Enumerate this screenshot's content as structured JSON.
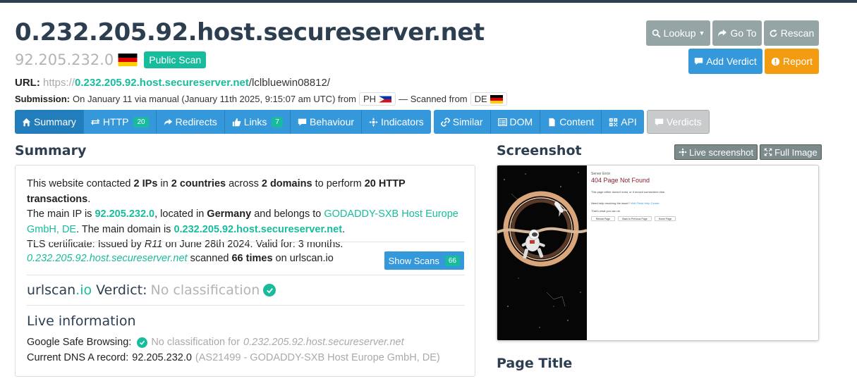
{
  "header": {
    "title": "0.232.205.92.host.secureserver.net",
    "ip": "92.205.232.0",
    "public_badge": "Public Scan"
  },
  "url": {
    "label": "URL:",
    "scheme": "https://",
    "domain": "0.232.205.92.host.secureserver.net",
    "path": "/lclbluewin08812/"
  },
  "submission": {
    "label": "Submission:",
    "text": "On January 11 via manual (January 11th 2025, 9:15:07 am UTC) from",
    "from_cc": "PH",
    "scanned_text": "— Scanned from",
    "scanned_cc": "DE"
  },
  "top_buttons": {
    "lookup": "Lookup",
    "goto": "Go To",
    "rescan": "Rescan",
    "add_verdict": "Add Verdict",
    "report": "Report"
  },
  "tabs": {
    "summary": "Summary",
    "http": "HTTP",
    "http_count": "20",
    "redirects": "Redirects",
    "links": "Links",
    "links_count": "7",
    "behaviour": "Behaviour",
    "indicators": "Indicators",
    "similar": "Similar",
    "dom": "DOM",
    "content": "Content",
    "api": "API",
    "verdicts": "Verdicts"
  },
  "summary": {
    "heading": "Summary",
    "p1_a": "This website contacted ",
    "p1_ips": "2 IPs",
    "p1_b": " in ",
    "p1_countries": "2 countries",
    "p1_c": " across ",
    "p1_domains": "2 domains",
    "p1_d": " to perform ",
    "p1_tx": "20 HTTP transactions",
    "p1_e": ".",
    "p2_a": "The main IP is ",
    "p2_ip": "92.205.232.0",
    "p2_b": ", located in ",
    "p2_country": "Germany",
    "p2_c": " and belongs to ",
    "p2_asn": "GODADDY-SXB Host Europe GmbH, DE",
    "p2_d": ". The main domain is ",
    "p2_domain": "0.232.205.92.host.secureserver.net",
    "p2_e": ".",
    "p3_a": "TLS certificate: Issued by ",
    "p3_issuer": "R11",
    "p3_b": " on June 28th 2024. Valid for: 3 months.",
    "scan_domain": "0.232.205.92.host.secureserver.net",
    "scan_a": " scanned ",
    "scan_times": "66 times",
    "scan_b": " on urlscan.io",
    "show_scans": "Show Scans",
    "show_scans_count": "66",
    "verdict_brand_a": "urlscan",
    "verdict_brand_b": ".io",
    "verdict_label": " Verdict:",
    "verdict_value": "No classification",
    "live_heading": "Live information",
    "gsb_label": "Google Safe Browsing:",
    "gsb_value": "No classification for",
    "gsb_domain": "0.232.205.92.host.secureserver.net",
    "dns_label": "Current DNS A record:",
    "dns_value": "92.205.232.0",
    "dns_asn": "(AS21499 - GODADDY-SXB Host Europe GmbH, DE)"
  },
  "screenshot": {
    "heading": "Screenshot",
    "live_btn": "Live screenshot",
    "full_btn": "Full Image",
    "server_error": "Server Error",
    "not_found": "404 Page Not Found",
    "line1": "This page either doesn't exist, or it moved somewhere else.",
    "line2": "Need help resolving the issue?",
    "line2_link": "Visit Plesk Help Center.",
    "line3": "That's what you can do",
    "btn1": "Reload Page",
    "btn2": "Back to Previous Page",
    "btn3": "Home Page"
  },
  "page_title": {
    "heading": "Page Title"
  },
  "colors": {
    "primary": "#2c3e50",
    "accent": "#18bc9c",
    "info": "#3498db",
    "warning": "#f39c12",
    "gray": "#95a5a6"
  }
}
